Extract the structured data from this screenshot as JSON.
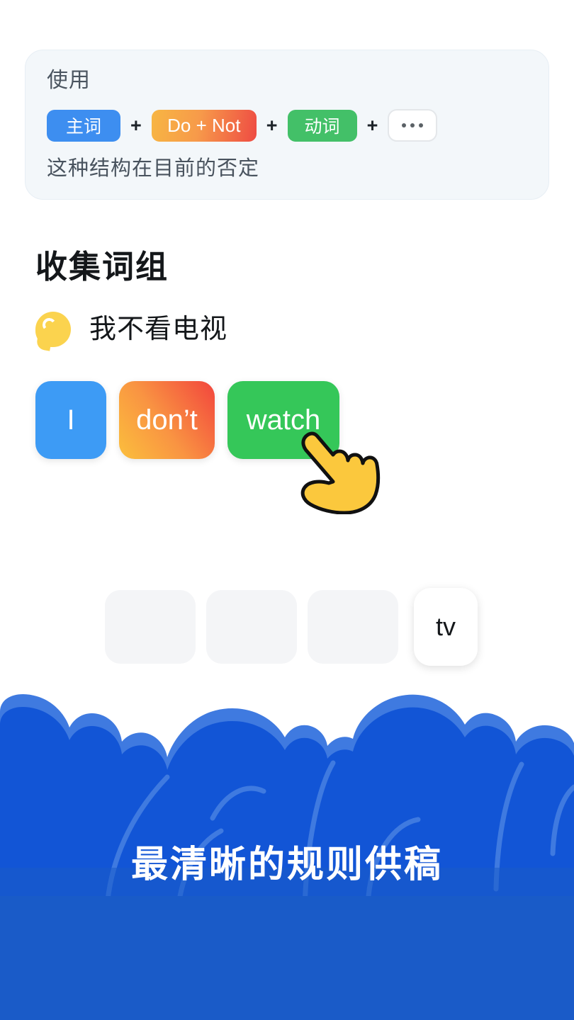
{
  "formula_card": {
    "label": "使用",
    "chips": [
      {
        "text": "主词",
        "kind": "subject"
      },
      {
        "text": "Do + Not",
        "kind": "donot"
      },
      {
        "text": "动词",
        "kind": "verb"
      },
      {
        "text": "...",
        "kind": "more"
      }
    ],
    "operator": "+",
    "description": "这种结构在目前的否定",
    "colors": {
      "card_bg": "#f3f7fa",
      "subject": "#3d8ef0",
      "donot_from": "#f7b643",
      "donot_to": "#ee4b43",
      "verb": "#43c068",
      "more_bg": "#ffffff"
    }
  },
  "section": {
    "title": "收集词组",
    "prompt_icon": "speech-bubble-icon",
    "prompt_text": "我不看电视"
  },
  "answer_tiles": [
    {
      "label": "I",
      "color": "#3d9bf5"
    },
    {
      "label": "don’t",
      "color": "#f2453d"
    },
    {
      "label": "watch",
      "color": "#35c759"
    }
  ],
  "cursor": {
    "icon": "pointing-hand-cursor",
    "fill": "#fbc83d",
    "stroke": "#111111"
  },
  "word_bank": {
    "empty_slots": 3,
    "filled": [
      {
        "label": "tv"
      }
    ],
    "slot_color": "#f4f5f7"
  },
  "banner": {
    "title": "最清晰的规则供稿",
    "colors": {
      "base": "#1a5bc8",
      "cloud": "#1255d6",
      "arc": "#3f7ae0",
      "title": "#ffffff"
    }
  }
}
